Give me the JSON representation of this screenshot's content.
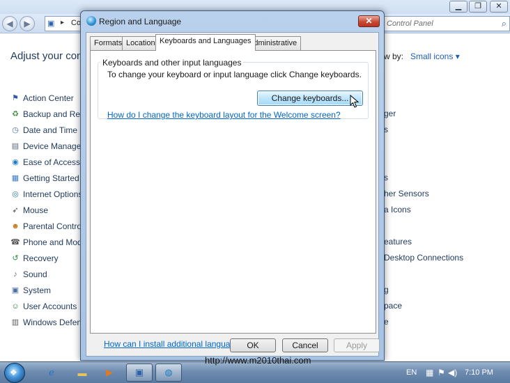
{
  "control_panel": {
    "title_buttons": [
      "▁",
      "❐",
      "✕"
    ],
    "address_text": "Co",
    "search_placeholder": "Control Panel",
    "heading": "Adjust your con",
    "view_by_label": "w by:",
    "view_by_value": "Small icons ▾",
    "left_items": [
      {
        "label": "Action Center",
        "icon": "flag-icon",
        "glyph": "⚑",
        "color": "#2a5aa8"
      },
      {
        "label": "Backup and Rest",
        "icon": "backup-icon",
        "glyph": "♻",
        "color": "#3b8a3b"
      },
      {
        "label": "Date and Time",
        "icon": "clock-icon",
        "glyph": "◷",
        "color": "#4a6d97"
      },
      {
        "label": "Device Manager",
        "icon": "device-manager-icon",
        "glyph": "▤",
        "color": "#5b6b7d"
      },
      {
        "label": "Ease of Access C",
        "icon": "ease-of-access-icon",
        "glyph": "◉",
        "color": "#1f7ac3"
      },
      {
        "label": "Getting Started",
        "icon": "getting-started-icon",
        "glyph": "▦",
        "color": "#3e7cc2"
      },
      {
        "label": "Internet Options",
        "icon": "internet-options-icon",
        "glyph": "◎",
        "color": "#2e7d9a"
      },
      {
        "label": "Mouse",
        "icon": "mouse-icon",
        "glyph": "➶",
        "color": "#444444"
      },
      {
        "label": "Parental Controls",
        "icon": "parental-controls-icon",
        "glyph": "☻",
        "color": "#c77a21"
      },
      {
        "label": "Phone and Mode",
        "icon": "phone-modem-icon",
        "glyph": "☎",
        "color": "#555555"
      },
      {
        "label": "Recovery",
        "icon": "recovery-icon",
        "glyph": "↺",
        "color": "#2b8a3e"
      },
      {
        "label": "Sound",
        "icon": "sound-icon",
        "glyph": "♪",
        "color": "#5a6a7c"
      },
      {
        "label": "System",
        "icon": "system-icon",
        "glyph": "▣",
        "color": "#4b6f9c"
      },
      {
        "label": "User Accounts",
        "icon": "user-accounts-icon",
        "glyph": "☺",
        "color": "#2f6f3a"
      },
      {
        "label": "Windows Defenc",
        "icon": "windows-defender-icon",
        "glyph": "▥",
        "color": "#5d5d5d"
      }
    ],
    "right_items": [
      {
        "label": "ger"
      },
      {
        "label": "s"
      },
      {
        "label": "s"
      },
      {
        "label": "her Sensors"
      },
      {
        "label": "a Icons"
      },
      {
        "label": "eatures"
      },
      {
        "label": " Desktop Connections"
      },
      {
        "label": "g"
      },
      {
        "label": "pace"
      },
      {
        "label": "e"
      }
    ]
  },
  "dialog": {
    "title": "Region and Language",
    "close_label": "✕",
    "tabs": [
      "Formats",
      "Location",
      "Keyboards and Languages",
      "Administrative"
    ],
    "group_legend": "Keyboards and other input languages",
    "group_description": "To change your keyboard or input language click Change keyboards.",
    "change_keyboards_label": "Change keyboards...",
    "welcome_link": "How do I change the keyboard layout for the Welcome screen?",
    "install_link": "How can I install additional languages?",
    "ok_label": "OK",
    "cancel_label": "Cancel",
    "apply_label": "Apply"
  },
  "taskbar": {
    "watermark": "http://www.m2010thai.com",
    "language": "EN",
    "clock": "7:10 PM",
    "buttons": [
      {
        "icon": "internet-explorer-icon",
        "glyph": "ℯ",
        "color": "#1e73c8"
      },
      {
        "icon": "folder-icon",
        "glyph": "▬",
        "color": "#e8c25a"
      },
      {
        "icon": "media-player-icon",
        "glyph": "▶",
        "color": "#e07a1f"
      },
      {
        "icon": "control-panel-icon",
        "glyph": "▣",
        "color": "#2b62a8"
      },
      {
        "icon": "region-globe-icon",
        "glyph": "◍",
        "color": "#1d7cc4"
      }
    ]
  }
}
